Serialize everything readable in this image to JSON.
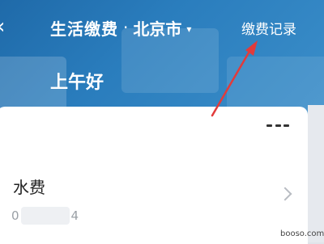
{
  "nav": {
    "title": "生活缴费",
    "dot": "·",
    "city": "北京市",
    "caret": "▾",
    "record_link": "缴费记录",
    "back_glyph": "‹"
  },
  "greeting": "上午好",
  "card": {
    "menu_icon": "more-dots",
    "items": [
      {
        "title": "水费",
        "sub_prefix": "0",
        "sub_suffix": "4",
        "chevron_icon": "chevron-right"
      }
    ]
  },
  "annotation": {
    "color": "#e23b3b"
  },
  "watermark": "booso.com",
  "colors": {
    "banner": "#2a7dbd",
    "card_bg": "#ffffff"
  }
}
